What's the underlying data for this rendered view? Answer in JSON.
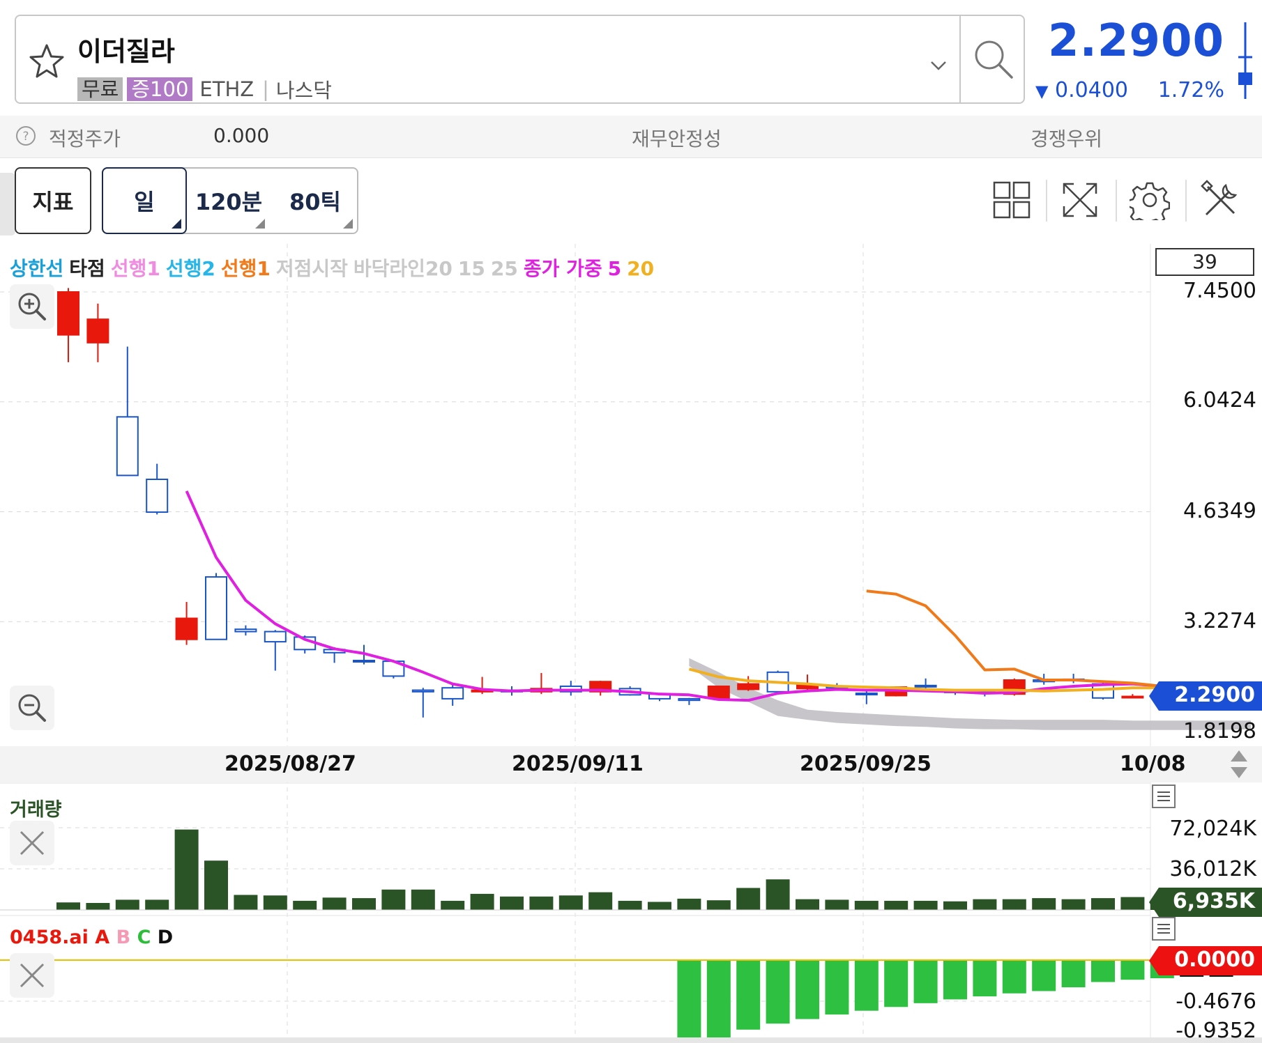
{
  "header": {
    "stock_name": "이더질라",
    "badge_free": "무료",
    "badge_margin": "증100",
    "ticker": "ETHZ",
    "separator": "|",
    "market": "나스닥",
    "price": "2.2900",
    "change": "0.0400",
    "change_pct": "1.72%",
    "price_color": "#1a4fd6"
  },
  "info_row": {
    "fair_price_label": "적정주가",
    "fair_price_value": "0.000",
    "stability_label": "재무안정성",
    "competitive_label": "경쟁우위"
  },
  "toolbar": {
    "indicator_label": "지표",
    "periods": [
      "일",
      "120분",
      "80틱"
    ],
    "active_period": "일",
    "icons": [
      "layout-grid-icon",
      "expand-icon",
      "settings-gear-icon",
      "tools-icon"
    ]
  },
  "legend": [
    {
      "text": "상한선",
      "color": "#1aa0d8"
    },
    {
      "text": "타점",
      "color": "#222222"
    },
    {
      "text": "선행1",
      "color": "#f08ce0"
    },
    {
      "text": "선행2",
      "color": "#25b5e8"
    },
    {
      "text": "선행1",
      "color": "#f07a1a"
    },
    {
      "text": "저점시작",
      "color": "#c8c8c8"
    },
    {
      "text": "바닥라인20",
      "color": "#c8c8c8"
    },
    {
      "text": "15",
      "color": "#c8c8c8"
    },
    {
      "text": "25",
      "color": "#c8c8c8"
    },
    {
      "text": "종가 가중",
      "color": "#e020e0"
    },
    {
      "text": "5",
      "color": "#e020e0"
    },
    {
      "text": "20",
      "color": "#f0b020"
    }
  ],
  "candle_count": "39",
  "price_axis": [
    "7.4500",
    "6.0424",
    "4.6349",
    "3.2274",
    "1.8198"
  ],
  "current_price_tag": "2.2900",
  "date_axis": [
    "2025/08/27",
    "2025/09/11",
    "2025/09/25",
    "10/08"
  ],
  "chart_data": [
    {
      "type": "candlestick",
      "title": "",
      "ylim": [
        1.8198,
        7.45
      ],
      "up_color": "#e8180c",
      "down_color": "#1a55c8",
      "candles": [
        {
          "o": 6.9,
          "h": 7.5,
          "l": 6.55,
          "c": 7.45
        },
        {
          "o": 6.8,
          "h": 7.3,
          "l": 6.55,
          "c": 7.1
        },
        {
          "o": 5.85,
          "h": 6.75,
          "l": 5.1,
          "c": 5.1
        },
        {
          "o": 5.05,
          "h": 5.25,
          "l": 4.6,
          "c": 4.63
        },
        {
          "o": 3.0,
          "h": 3.48,
          "l": 2.93,
          "c": 3.27
        },
        {
          "o": 3.8,
          "h": 3.85,
          "l": 3.0,
          "c": 3.0
        },
        {
          "o": 3.13,
          "h": 3.18,
          "l": 3.05,
          "c": 3.1
        },
        {
          "o": 3.1,
          "h": 3.12,
          "l": 2.6,
          "c": 2.97
        },
        {
          "o": 3.03,
          "h": 3.05,
          "l": 2.82,
          "c": 2.87
        },
        {
          "o": 2.87,
          "h": 2.9,
          "l": 2.7,
          "c": 2.83
        },
        {
          "o": 2.73,
          "h": 2.93,
          "l": 2.68,
          "c": 2.72
        },
        {
          "o": 2.72,
          "h": 2.73,
          "l": 2.5,
          "c": 2.53
        },
        {
          "o": 2.35,
          "h": 2.38,
          "l": 2.0,
          "c": 2.33
        },
        {
          "o": 2.38,
          "h": 2.42,
          "l": 2.15,
          "c": 2.24
        },
        {
          "o": 2.33,
          "h": 2.52,
          "l": 2.3,
          "c": 2.35
        },
        {
          "o": 2.35,
          "h": 2.4,
          "l": 2.28,
          "c": 2.33
        },
        {
          "o": 2.33,
          "h": 2.57,
          "l": 2.3,
          "c": 2.37
        },
        {
          "o": 2.4,
          "h": 2.47,
          "l": 2.28,
          "c": 2.33
        },
        {
          "o": 2.33,
          "h": 2.47,
          "l": 2.28,
          "c": 2.46
        },
        {
          "o": 2.37,
          "h": 2.4,
          "l": 2.28,
          "c": 2.29
        },
        {
          "o": 2.3,
          "h": 2.31,
          "l": 2.21,
          "c": 2.24
        },
        {
          "o": 2.24,
          "h": 2.25,
          "l": 2.16,
          "c": 2.22
        },
        {
          "o": 2.25,
          "h": 2.4,
          "l": 2.24,
          "c": 2.4
        },
        {
          "o": 2.36,
          "h": 2.53,
          "l": 2.34,
          "c": 2.43
        },
        {
          "o": 2.58,
          "h": 2.6,
          "l": 2.32,
          "c": 2.33
        },
        {
          "o": 2.37,
          "h": 2.55,
          "l": 2.34,
          "c": 2.42
        },
        {
          "o": 2.4,
          "h": 2.44,
          "l": 2.35,
          "c": 2.38
        },
        {
          "o": 2.31,
          "h": 2.34,
          "l": 2.17,
          "c": 2.3
        },
        {
          "o": 2.28,
          "h": 2.4,
          "l": 2.27,
          "c": 2.39
        },
        {
          "o": 2.41,
          "h": 2.5,
          "l": 2.36,
          "c": 2.4
        },
        {
          "o": 2.34,
          "h": 2.36,
          "l": 2.29,
          "c": 2.32
        },
        {
          "o": 2.33,
          "h": 2.36,
          "l": 2.27,
          "c": 2.31
        },
        {
          "o": 2.3,
          "h": 2.5,
          "l": 2.28,
          "c": 2.48
        },
        {
          "o": 2.48,
          "h": 2.56,
          "l": 2.42,
          "c": 2.46
        },
        {
          "o": 2.49,
          "h": 2.56,
          "l": 2.44,
          "c": 2.48
        },
        {
          "o": 2.43,
          "h": 2.45,
          "l": 2.23,
          "c": 2.25
        },
        {
          "o": 2.27,
          "h": 2.3,
          "l": 2.25,
          "c": 2.27
        }
      ],
      "lines": [
        {
          "name": "종가 가중 5",
          "color": "#e020e0",
          "start_index": 4,
          "values": [
            4.9,
            4.05,
            3.5,
            3.2,
            3.0,
            2.88,
            2.82,
            2.72,
            2.58,
            2.43,
            2.36,
            2.34,
            2.35,
            2.35,
            2.35,
            2.33,
            2.3,
            2.29,
            2.23,
            2.22,
            2.31,
            2.34,
            2.36,
            2.35,
            2.35,
            2.34,
            2.33,
            2.31,
            2.32,
            2.37,
            2.4,
            2.42,
            2.43,
            2.4,
            2.37
          ]
        },
        {
          "name": "20",
          "color": "#f0b020",
          "start_index": 21,
          "values": [
            2.62,
            2.52,
            2.47,
            2.45,
            2.43,
            2.4,
            2.39,
            2.38,
            2.36,
            2.35,
            2.35,
            2.35,
            2.34,
            2.35,
            2.36,
            2.38,
            2.38,
            2.38,
            2.37
          ]
        },
        {
          "name": "선행1",
          "color": "#f07a1a",
          "start_index": 27,
          "values": [
            3.62,
            3.58,
            3.43,
            3.05,
            2.61,
            2.62,
            2.48,
            2.48,
            2.46,
            2.44,
            2.4
          ]
        }
      ],
      "band": {
        "name": "바닥라인20",
        "color": "#c4c2c7",
        "start_index": 21,
        "upper": [
          2.76,
          2.58,
          2.38,
          2.22,
          2.1,
          2.07,
          2.05,
          2.03,
          2.01,
          1.99,
          1.98,
          1.97,
          1.97,
          1.97,
          1.97,
          1.96,
          1.96,
          1.96,
          1.96,
          1.96
        ],
        "lower": [
          2.66,
          2.38,
          2.2,
          2.02,
          1.97,
          1.93,
          1.91,
          1.89,
          1.88,
          1.86,
          1.85,
          1.85,
          1.84,
          1.84,
          1.84,
          1.84,
          1.84,
          1.84,
          1.84,
          1.85
        ]
      }
    },
    {
      "type": "bar",
      "title": "거래량",
      "color": "#2b5426",
      "ylim": [
        0,
        78000
      ],
      "y_ticks": [
        "72,024K",
        "36,012K"
      ],
      "last_value_tag": "6,935K",
      "values": [
        7000,
        6500,
        9500,
        9500,
        75000,
        46000,
        14000,
        13500,
        8500,
        11500,
        11000,
        19000,
        19000,
        8500,
        15000,
        12500,
        12500,
        13500,
        16500,
        8500,
        7500,
        10500,
        9000,
        20500,
        28500,
        10000,
        9500,
        8500,
        8500,
        8500,
        8000,
        10000,
        10000,
        11000,
        10000,
        11000,
        12000,
        7500
      ]
    },
    {
      "type": "bar",
      "title": "0458.ai A B C D",
      "series_labels": [
        {
          "text": "0458.ai",
          "color": "#e8180c"
        },
        {
          "text": "A",
          "color": "#e8180c"
        },
        {
          "text": "B",
          "color": "#f59ab4"
        },
        {
          "text": "C",
          "color": "#2ebd3a"
        },
        {
          "text": "D",
          "color": "#111111"
        }
      ],
      "ylim": [
        -1.06,
        0.06
      ],
      "y_ticks": [
        "-0.4676",
        "-0.9352"
      ],
      "zero_tag": "0.0000",
      "start_index": 21,
      "values": [
        -1.06,
        -1.04,
        -0.92,
        -0.84,
        -0.78,
        -0.72,
        -0.67,
        -0.62,
        -0.57,
        -0.52,
        -0.48,
        -0.44,
        -0.41,
        -0.36,
        -0.29,
        -0.26,
        -0.24,
        -0.22,
        -0.22
      ],
      "colors": [
        "#2ec040",
        "#2ec040",
        "#2ec040",
        "#2ec040",
        "#2ec040",
        "#2ec040",
        "#2ec040",
        "#2ec040",
        "#2ec040",
        "#2ec040",
        "#2ec040",
        "#2ec040",
        "#2ec040",
        "#2ec040",
        "#2ec040",
        "#2ec040",
        "#2ec040",
        "#000000",
        "#000000"
      ]
    }
  ]
}
